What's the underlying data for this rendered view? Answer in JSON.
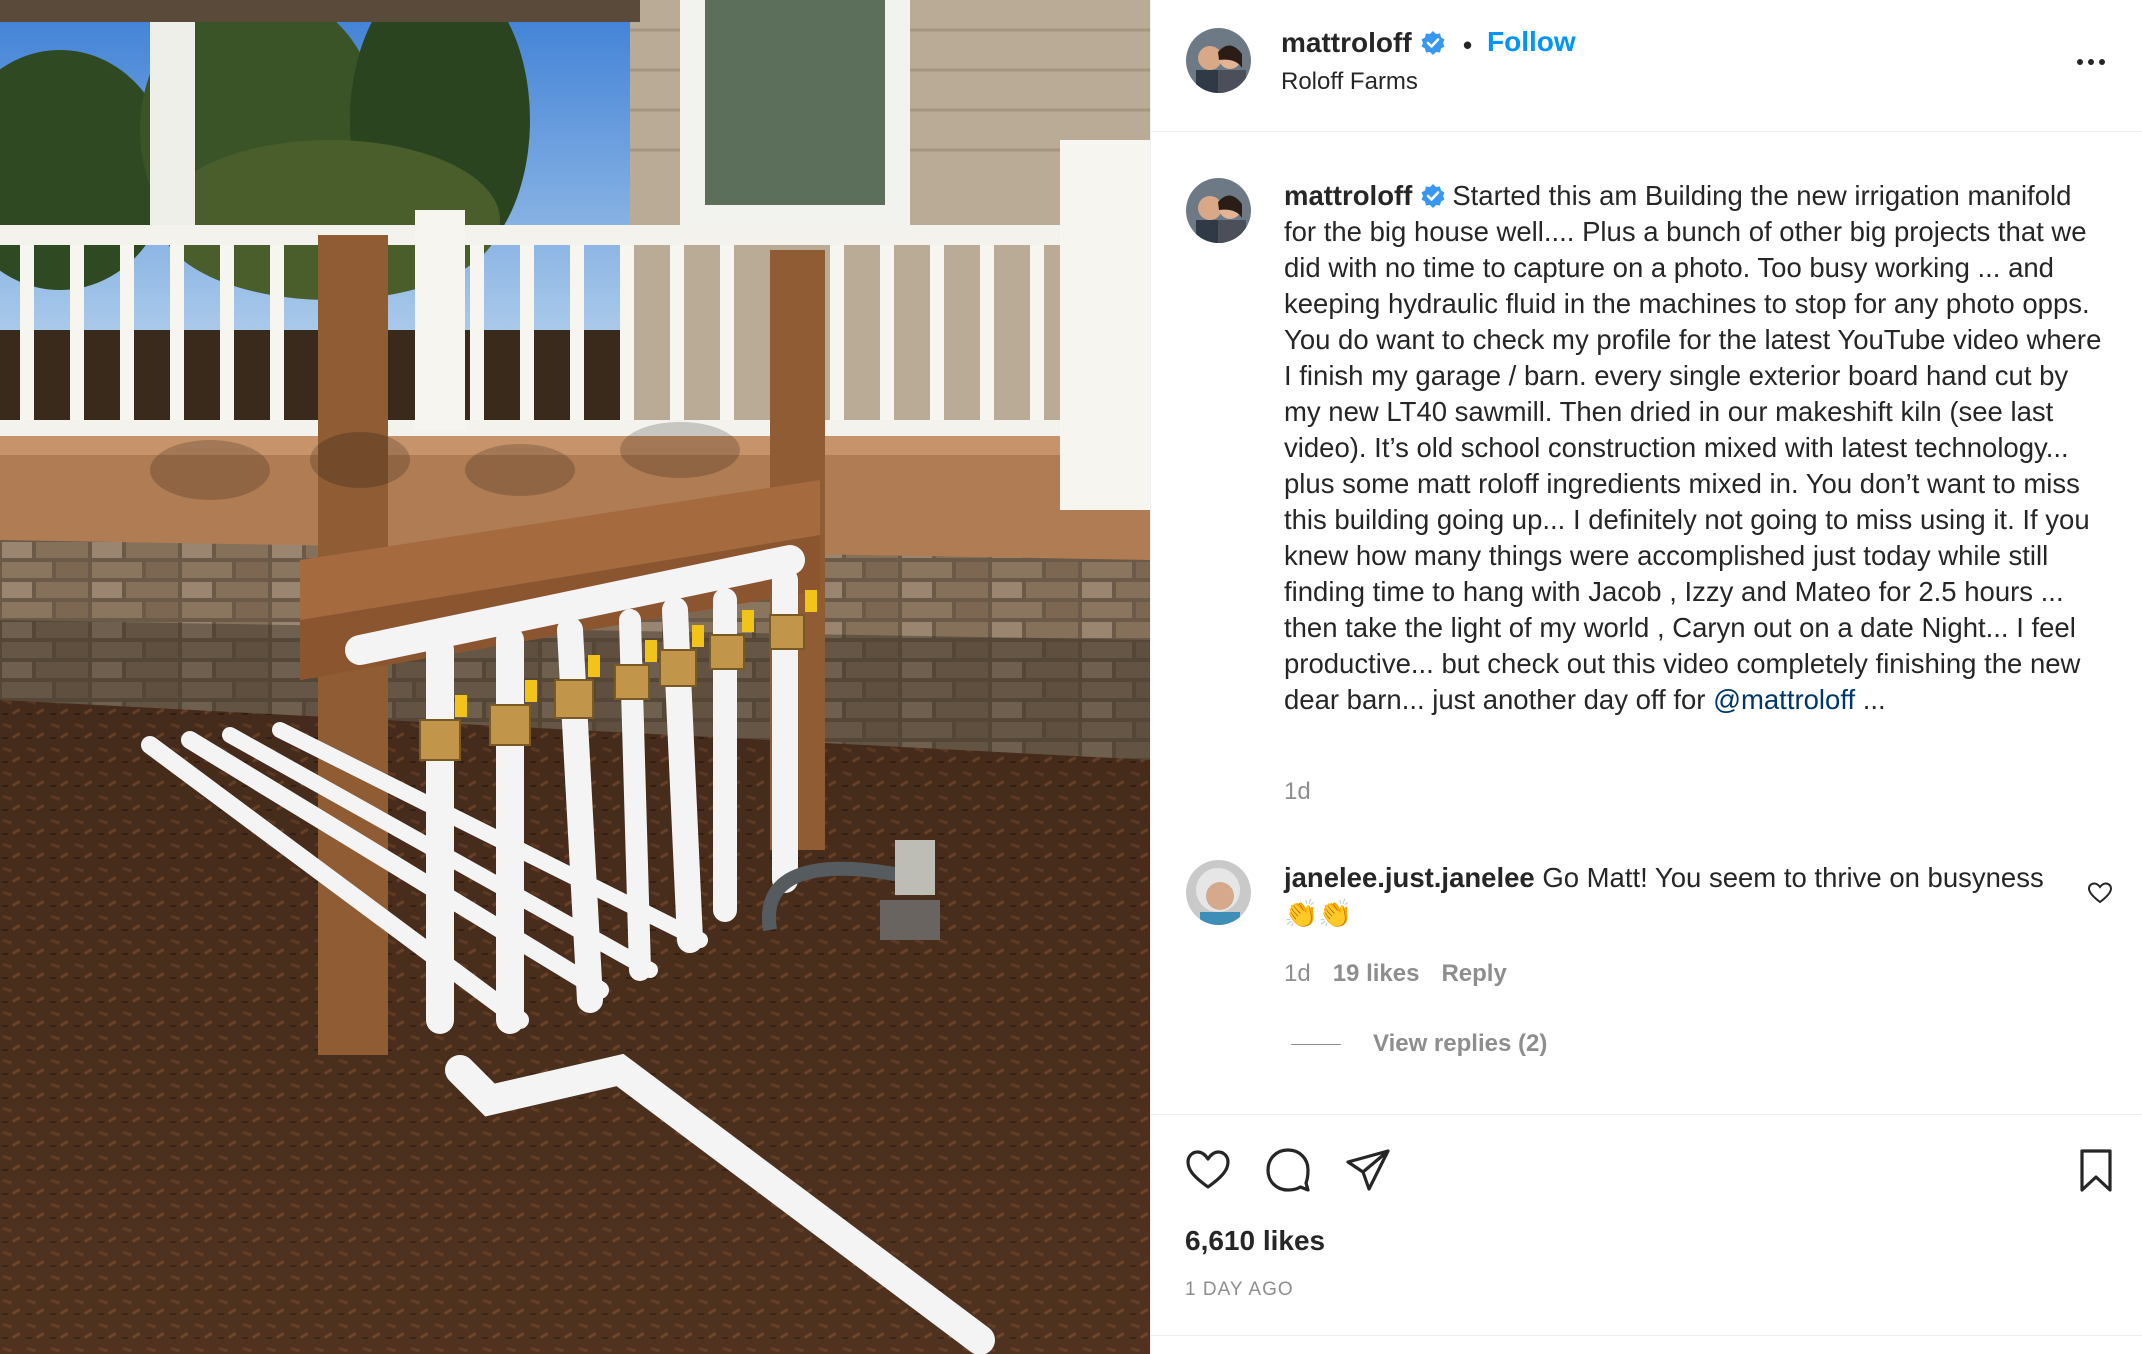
{
  "post": {
    "username": "mattroloff",
    "separator": "•",
    "follow_label": "Follow",
    "location": "Roloff Farms",
    "caption": {
      "username": "mattroloff",
      "text": "Started this am Building the new irrigation manifold for the big house well.... Plus a bunch of other big projects that we did with no time to capture on a photo. Too busy working ... and keeping hydraulic fluid in the machines to stop for any photo opps. You do want to check my profile for the latest YouTube video where I finish my garage / barn. every single exterior board hand cut by my new LT40 sawmill. Then dried in our makeshift kiln (see last video). It’s old school construction mixed with latest technology... plus some matt roloff ingredients mixed in. You don’t want to miss this building going up... I definitely not going to miss using it. If you knew how many things were accomplished just today while still finding time to hang with Jacob , Izzy and Mateo for 2.5 hours ... then take the light of my world , Caryn out on a date Night... I feel productive... but check out this video completely finishing the new dear barn... just another day off for ",
      "mention": "@mattroloff",
      "suffix": " ...",
      "time": "1d"
    },
    "comment": {
      "username": "janelee.just.janelee",
      "text": " Go Matt! You seem to thrive on busyness 👏👏",
      "time": "1d",
      "likes": "19 likes",
      "reply_label": "Reply",
      "view_replies": "View replies (2)"
    },
    "likes_count": "6,610 likes",
    "post_time": "1 DAY AGO"
  },
  "icons": {
    "verified": "verified-badge-icon",
    "more": "more-options-icon",
    "like": "heart-icon",
    "comment": "comment-bubble-icon",
    "share": "paper-plane-icon",
    "save": "bookmark-icon"
  },
  "colors": {
    "link_blue": "#0095f6",
    "mention_blue": "#00376b",
    "secondary_text": "#8e8e8e",
    "primary_text": "#262626"
  }
}
